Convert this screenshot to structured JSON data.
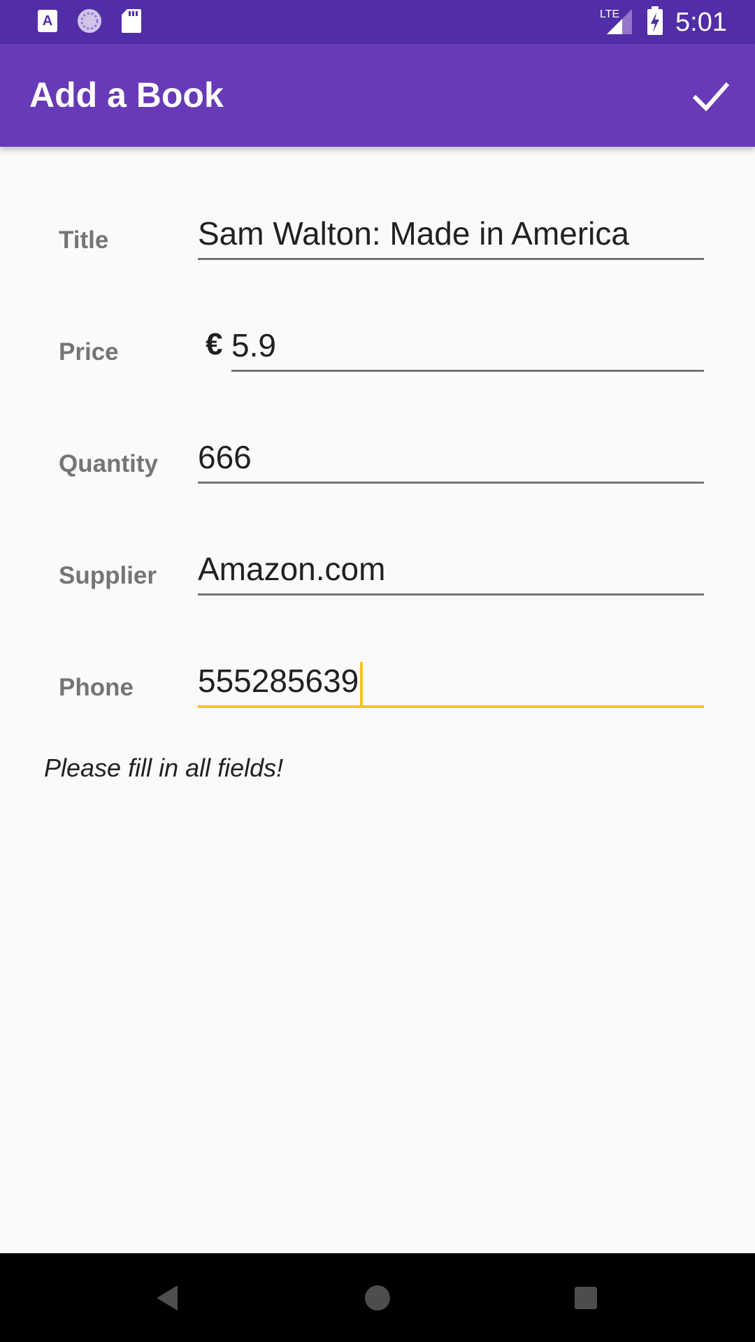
{
  "status_bar": {
    "time": "5:01",
    "network": "LTE",
    "icons": [
      "app-a-icon",
      "loading-icon",
      "sd-card-icon",
      "lte-signal-icon",
      "battery-charging-icon"
    ]
  },
  "app_bar": {
    "title": "Add a Book",
    "action_icon": "check-icon"
  },
  "form": {
    "fields": [
      {
        "label": "Title",
        "value": "Sam Walton: Made in America"
      },
      {
        "label": "Price",
        "prefix": "€",
        "value": "5.9"
      },
      {
        "label": "Quantity",
        "value": "666"
      },
      {
        "label": "Supplier",
        "value": "Amazon.com"
      },
      {
        "label": "Phone",
        "value": "555285639"
      }
    ],
    "hint": "Please fill in all fields!"
  },
  "colors": {
    "status_bar": "#512da8",
    "app_bar": "#673ab7",
    "accent": "#f5c518"
  },
  "nav_bar": {
    "icons": [
      "back-icon",
      "home-icon",
      "recents-icon"
    ]
  }
}
